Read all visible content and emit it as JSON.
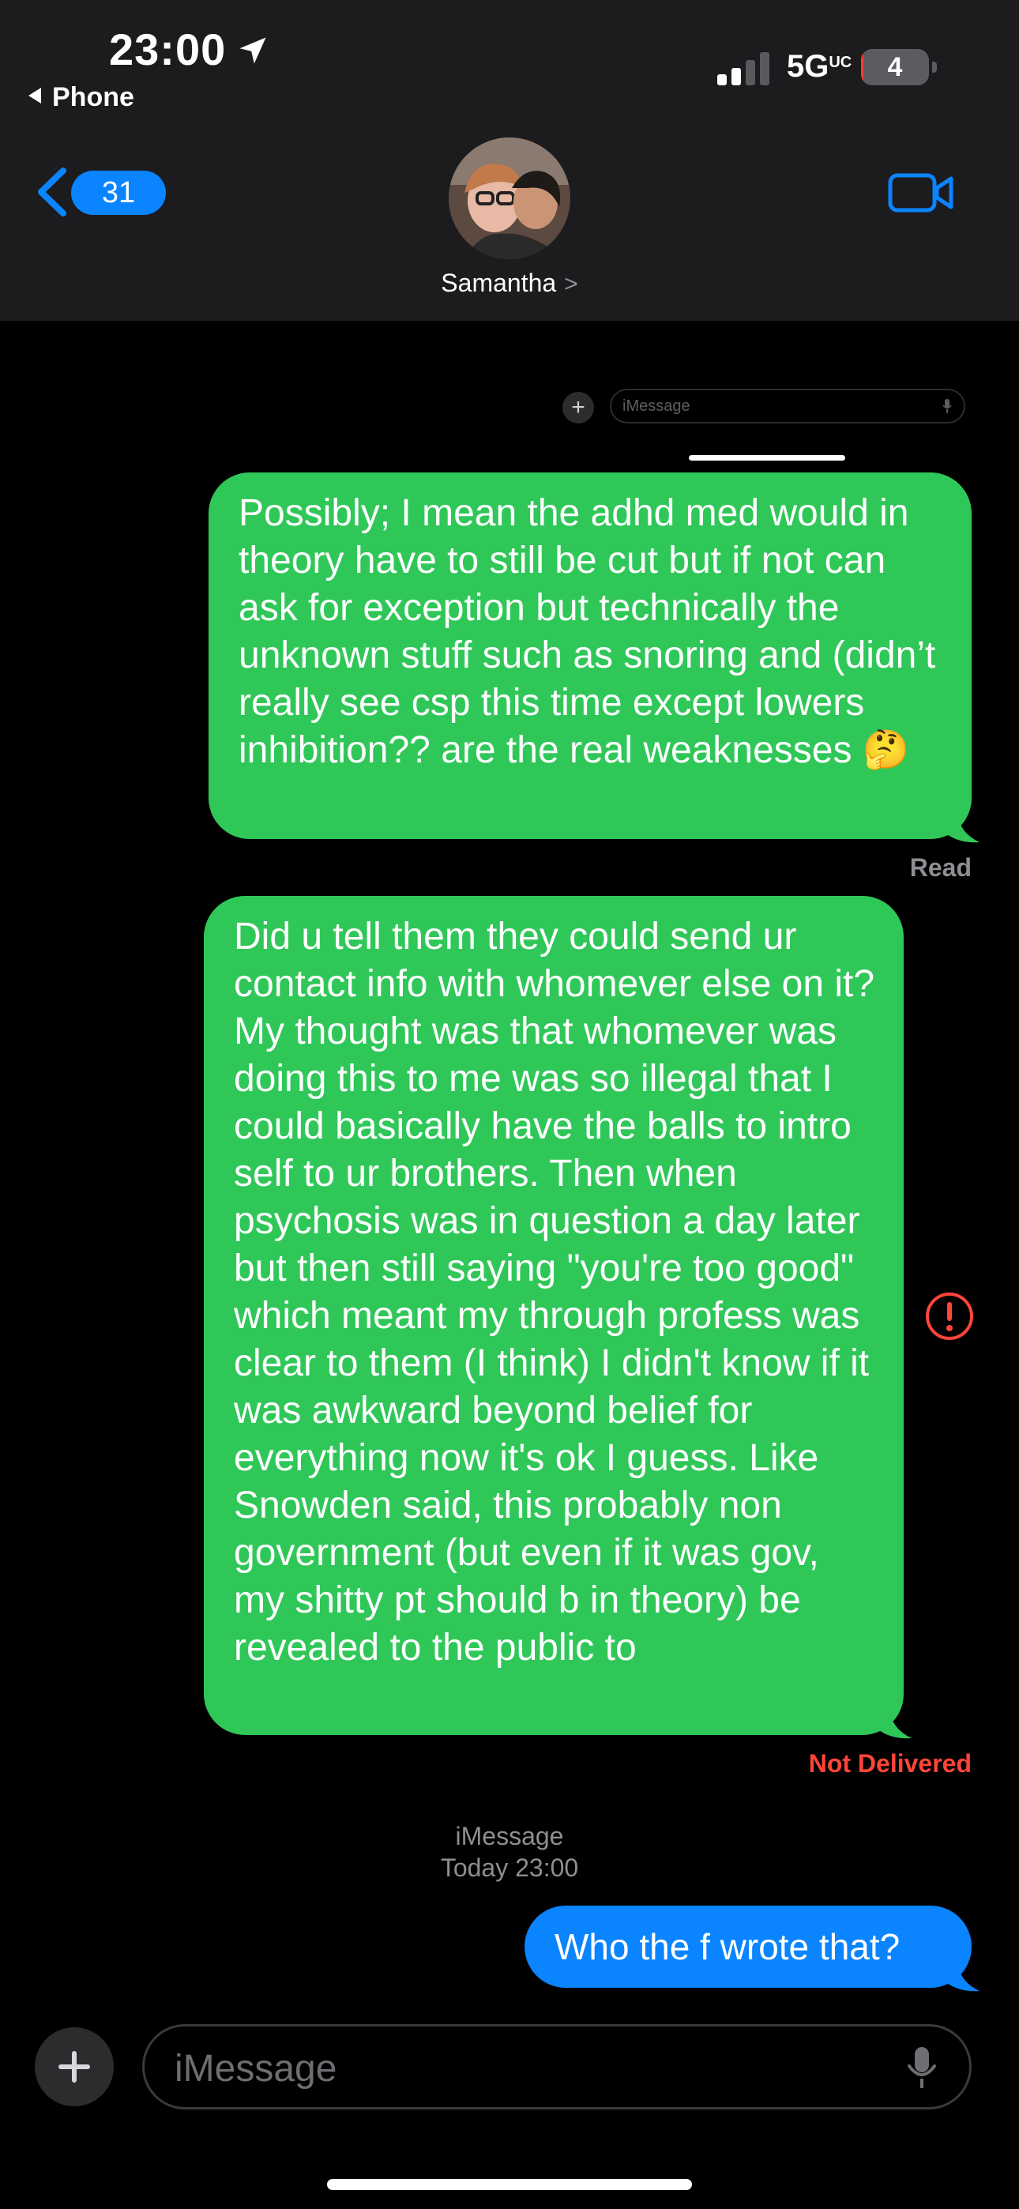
{
  "status_bar": {
    "time": "23:00",
    "back_app": "Phone",
    "network": "5G",
    "network_suffix": "UC",
    "battery": "4",
    "battery_level_pct": 4,
    "icons": [
      "location-arrow-icon",
      "signal-icon",
      "battery-icon"
    ]
  },
  "header": {
    "back_count": "31",
    "contact_name": "Samantha",
    "chevron": ">",
    "icons": [
      "chevron-left-icon",
      "video-camera-icon",
      "avatar"
    ]
  },
  "embedded_screenshot": {
    "input_placeholder": "iMessage",
    "plus": "+"
  },
  "messages": [
    {
      "text": "Possibly; I mean the adhd med would in theory have to still be cut but if not can ask for exception but technically the unknown stuff such as snoring and (didn’t really see csp this time except lowers inhibition?? are the real weaknesses 🤔",
      "color": "green",
      "status": "Read"
    },
    {
      "text": "Did u tell them they could send ur contact info with whomever else on it? My thought was that whomever was doing this to me was so illegal that I could basically have the balls to intro self to ur brothers. Then when psychosis was in question a day later but then still saying \"you're too good\" which meant my through profess was clear to them (I think) I didn't know if it was awkward beyond belief for everything now it's ok I guess. Like Snowden said, this probably non government (but even if it was gov, my shitty pt should b in theory) be revealed to the public to",
      "color": "green",
      "status": "Not Delivered"
    },
    {
      "text": "Who the f wrote that?",
      "color": "blue",
      "status": ""
    }
  ],
  "service_label": "iMessage",
  "service_time": "Today 23:00",
  "composer": {
    "placeholder": "iMessage",
    "icons": [
      "plus-icon",
      "microphone-icon"
    ]
  },
  "colors": {
    "green_bubble": "#30c759",
    "blue_bubble": "#0a84ff",
    "accent": "#0a84ff",
    "error": "#ff453a",
    "header_bg": "#1c1c1e"
  }
}
